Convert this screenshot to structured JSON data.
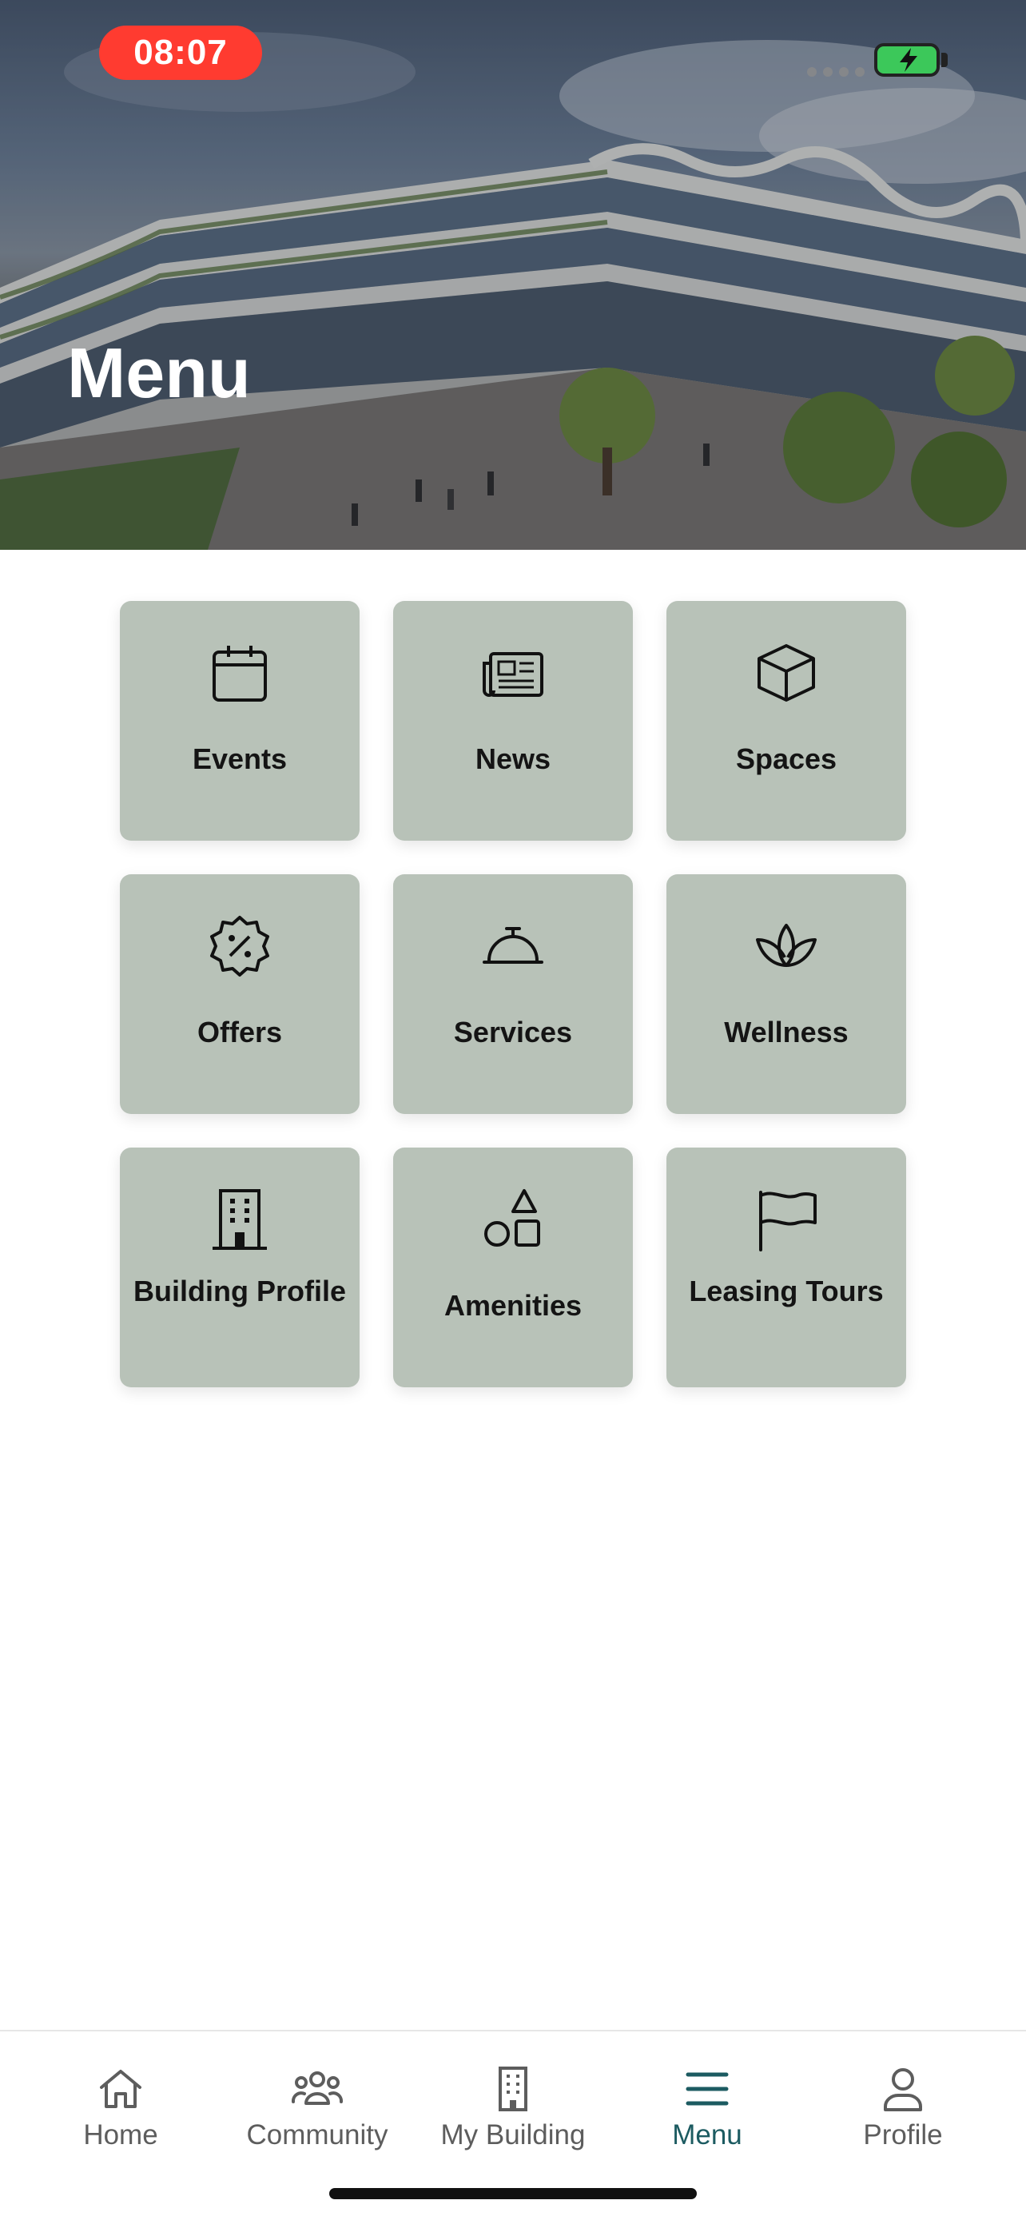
{
  "status_bar": {
    "time": "08:07",
    "battery_color": "#3cc85a",
    "time_pill_color": "#ff3b30"
  },
  "header": {
    "title": "Menu",
    "background": "building-photo"
  },
  "menu": {
    "tile_color": "#b8c2b8",
    "items": [
      {
        "label": "Events",
        "icon": "calendar-icon"
      },
      {
        "label": "News",
        "icon": "newspaper-icon"
      },
      {
        "label": "Spaces",
        "icon": "cube-icon"
      },
      {
        "label": "Offers",
        "icon": "percent-badge-icon"
      },
      {
        "label": "Services",
        "icon": "service-bell-icon"
      },
      {
        "label": "Wellness",
        "icon": "lotus-icon"
      },
      {
        "label": "Building Profile",
        "icon": "building-icon"
      },
      {
        "label": "Amenities",
        "icon": "shapes-icon"
      },
      {
        "label": "Leasing Tours",
        "icon": "flag-icon"
      }
    ]
  },
  "bottom_nav": {
    "active_color": "#1c5b61",
    "items": [
      {
        "label": "Home",
        "icon": "home-icon",
        "active": false
      },
      {
        "label": "Community",
        "icon": "community-icon",
        "active": false
      },
      {
        "label": "My Building",
        "icon": "building-icon",
        "active": false
      },
      {
        "label": "Menu",
        "icon": "menu-icon",
        "active": true
      },
      {
        "label": "Profile",
        "icon": "profile-icon",
        "active": false
      }
    ]
  }
}
